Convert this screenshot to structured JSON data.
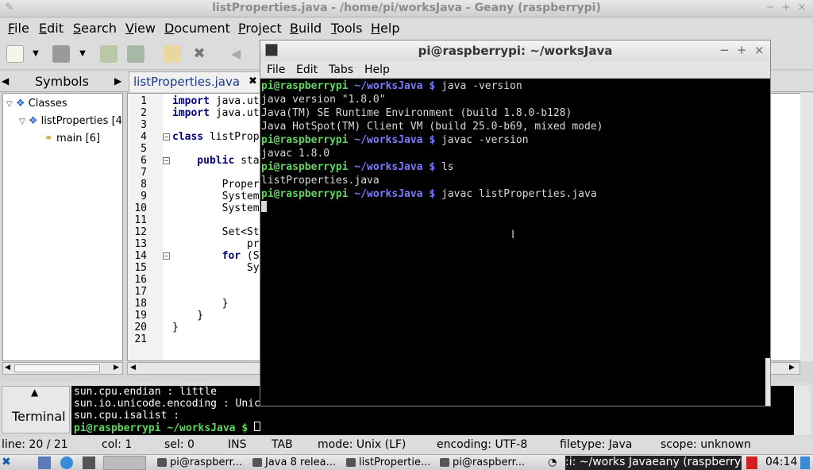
{
  "geany": {
    "title": "listProperties.java - /home/pi/worksJava - Geany (raspberrypi)",
    "menu": [
      "File",
      "Edit",
      "Search",
      "View",
      "Document",
      "Project",
      "Build",
      "Tools",
      "Help"
    ],
    "sidebar_tab": "Symbols",
    "tree": {
      "root": "Classes",
      "class": "listProperties [4",
      "method": "main [6]"
    },
    "editor_tab": "listProperties.java",
    "lines": [
      {
        "n": "1",
        "kw": "import",
        "rest": " java.ut"
      },
      {
        "n": "2",
        "kw": "import",
        "rest": " java.ut"
      },
      {
        "n": "3",
        "kw": "",
        "rest": ""
      },
      {
        "n": "4",
        "kw": "class",
        "rest": " listProp"
      },
      {
        "n": "5",
        "kw": "",
        "rest": ""
      },
      {
        "n": "6",
        "kw": "    public",
        "rest": " sta"
      },
      {
        "n": "7",
        "kw": "",
        "rest": ""
      },
      {
        "n": "8",
        "kw": "",
        "rest": "        Proper"
      },
      {
        "n": "9",
        "kw": "",
        "rest": "        System"
      },
      {
        "n": "10",
        "kw": "",
        "rest": "        System"
      },
      {
        "n": "11",
        "kw": "",
        "rest": ""
      },
      {
        "n": "12",
        "kw": "",
        "rest": "        Set<St"
      },
      {
        "n": "13",
        "kw": "",
        "rest": "            pr"
      },
      {
        "n": "14",
        "kw": "        for",
        "rest": " (S"
      },
      {
        "n": "15",
        "kw": "",
        "rest": "            Sy"
      },
      {
        "n": "16",
        "kw": "",
        "rest": ""
      },
      {
        "n": "17",
        "kw": "",
        "rest": ""
      },
      {
        "n": "18",
        "kw": "",
        "rest": "        }"
      },
      {
        "n": "19",
        "kw": "",
        "rest": "    }"
      },
      {
        "n": "20",
        "kw": "",
        "rest": "}"
      },
      {
        "n": "21",
        "kw": "",
        "rest": ""
      }
    ],
    "message_tab": "Terminal",
    "messages": [
      "sun.cpu.endian : little",
      "sun.io.unicode.encoding : UnicodeLittle",
      "sun.cpu.isalist :"
    ],
    "message_prompt": "pi@raspberrypi ~/worksJava $"
  },
  "status": {
    "line": "line: 20 / 21",
    "col": "col: 1",
    "sel": "sel: 0",
    "ins": "INS",
    "tab": "TAB",
    "mode": "mode: Unix (LF)",
    "encoding": "encoding: UTF-8",
    "filetype": "filetype: Java",
    "scope": "scope: unknown"
  },
  "terminal": {
    "title": "pi@raspberrypi: ~/worksJava",
    "menu": [
      "File",
      "Edit",
      "Tabs",
      "Help"
    ],
    "prompt_user": "pi@raspberrypi",
    "prompt_path": "~/worksJava $",
    "lines": [
      {
        "type": "cmd",
        "text": " java -version"
      },
      {
        "type": "out",
        "text": "java version \"1.8.0\""
      },
      {
        "type": "out",
        "text": "Java(TM) SE Runtime Environment (build 1.8.0-b128)"
      },
      {
        "type": "out",
        "text": "Java HotSpot(TM) Client VM (build 25.0-b69, mixed mode)"
      },
      {
        "type": "cmd",
        "text": " javac -version"
      },
      {
        "type": "out",
        "text": "javac 1.8.0"
      },
      {
        "type": "cmd",
        "text": " ls"
      },
      {
        "type": "out",
        "text": "listProperties.java"
      },
      {
        "type": "cmd",
        "text": " javac listProperties.java"
      }
    ]
  },
  "taskbar": {
    "tasks": [
      "pi@raspberr...",
      "Java 8 relea...",
      "listPropertie...",
      "pi@raspberr..."
    ],
    "active_title": ":i: ~/works Java",
    "active_title2": "eany (raspberrypi)",
    "clock": "04:14"
  },
  "colors": {
    "prompt_user": "#5fd75f",
    "prompt_path": "#7a7aff",
    "keyword": "#00007f"
  }
}
